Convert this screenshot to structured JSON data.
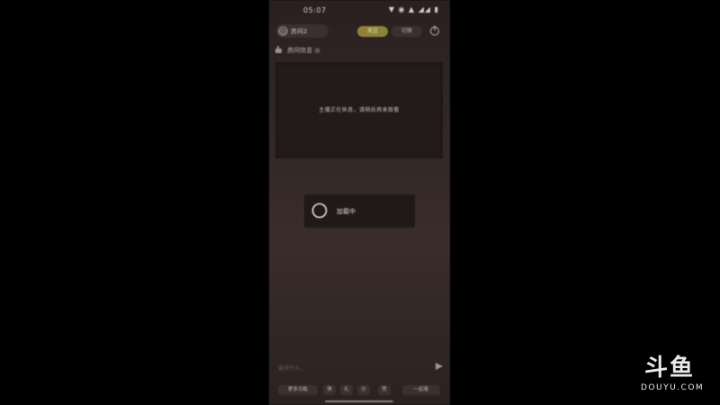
{
  "status_bar": {
    "time": "05:07",
    "icons": "▼ ◉ ▲ ◢◢ ▮"
  },
  "header": {
    "room_avatar": "☺",
    "room_name": "房间2",
    "follow_label": "关注",
    "mode_label": "切换",
    "power_icon": "power-icon"
  },
  "subhead": {
    "label": "房间信息 ◎"
  },
  "video": {
    "message": "主播正在休息，请稍后再来观看"
  },
  "loading": {
    "text": "加载中"
  },
  "chat": {
    "placeholder": "说点什么..."
  },
  "toolbar": {
    "buttons": [
      "更多功能",
      "弹",
      "礼",
      "分",
      "赞",
      "一起看"
    ]
  },
  "watermark": {
    "logo": "斗鱼",
    "text": "DOUYU.COM"
  },
  "colors": {
    "follow_accent": "#8d8238",
    "background": "#000000"
  }
}
